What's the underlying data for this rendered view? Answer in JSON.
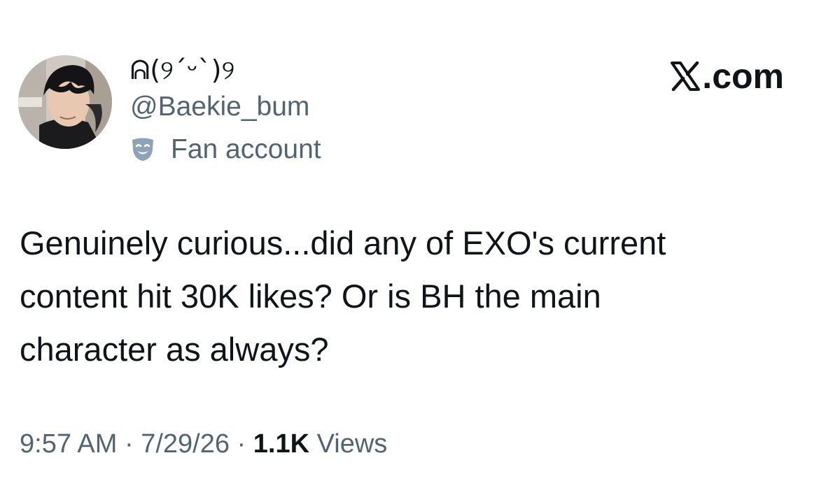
{
  "author": {
    "display_name": "ᕱ(୨ˊᵕˋ)୨",
    "handle": "@Baekie_bum",
    "affiliation_icon": "fan-mask-icon",
    "affiliation_label": "Fan account"
  },
  "brand": {
    "icon": "x-logo-icon",
    "label": ".com"
  },
  "tweet": {
    "lines": [
      "Genuinely curious...did any of EXO's current",
      "content hit 30K likes? Or is BH the main",
      "character as always?"
    ]
  },
  "meta": {
    "time": "9:57 AM",
    "separator": " · ",
    "date": "7/29/26",
    "views_count": "1.1K",
    "views_label": "Views"
  },
  "colors": {
    "text_primary": "#0f1419",
    "text_secondary": "#536471",
    "background": "#ffffff"
  }
}
